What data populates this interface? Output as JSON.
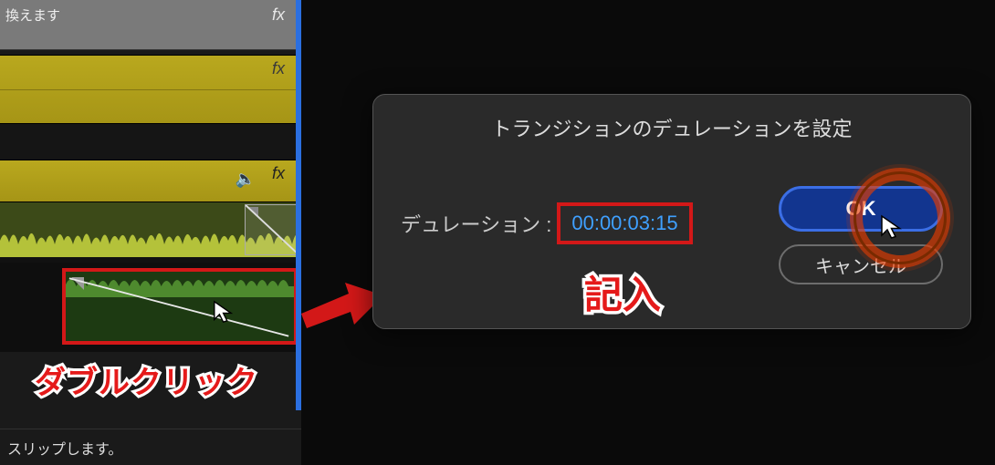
{
  "timeline": {
    "track1_hint": "換えます",
    "fx_label": "fx",
    "speaker_icon": "🔈",
    "footer_hint": "スリップします。"
  },
  "annotations": {
    "double_click": "ダブルクリック",
    "enter": "記入"
  },
  "dialog": {
    "title": "トランジションのデュレーションを設定",
    "duration_label": "デュレーション :",
    "duration_value": "00:00:03:15",
    "ok_label": "OK",
    "cancel_label": "キャンセル"
  }
}
